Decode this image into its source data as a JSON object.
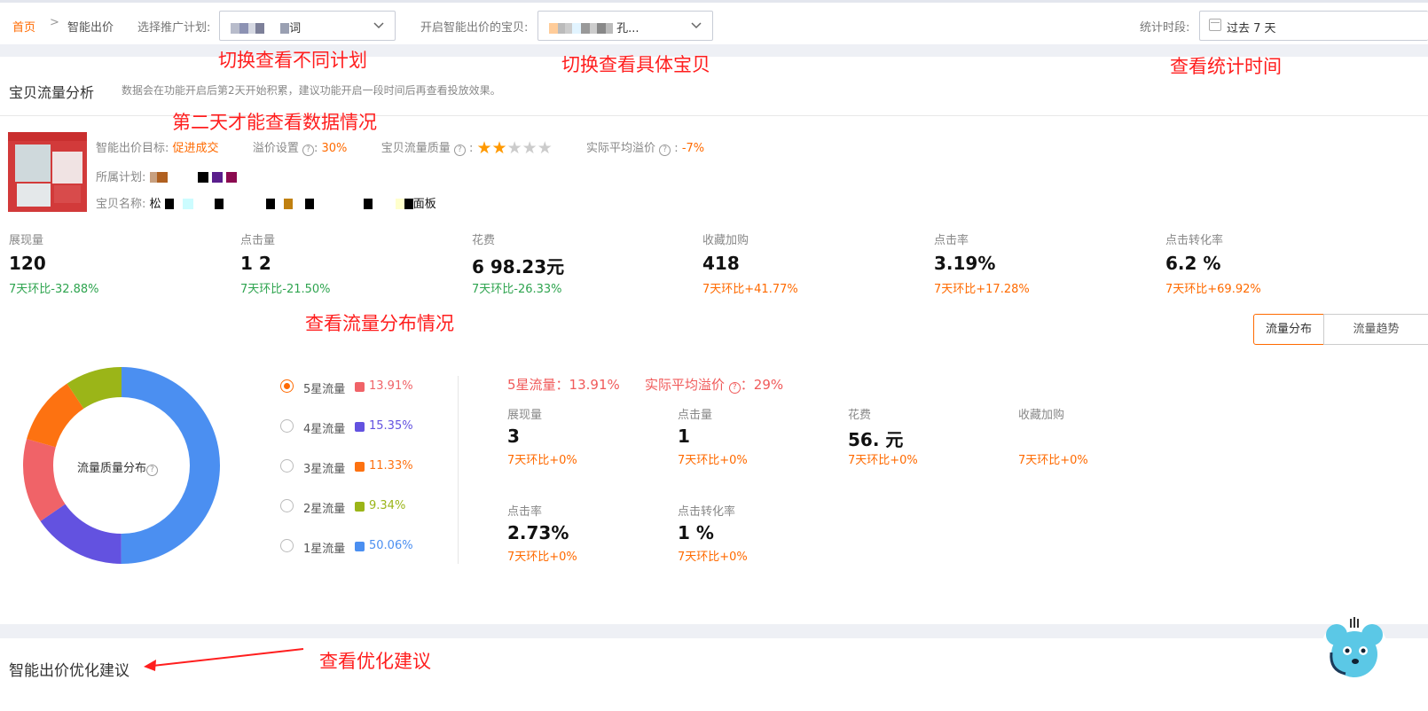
{
  "header": {
    "breadcrumb_home": "首页",
    "breadcrumb_sep": ">",
    "breadcrumb_current": "智能出价",
    "plan_label": "选择推广计划:",
    "plan_value": "词",
    "item_label": "开启智能出价的宝贝:",
    "item_value": "孔...",
    "period_label": "统计时段:",
    "period_value": "过去 7 天"
  },
  "annotations": {
    "switch_plan": "切换查看不同计划",
    "switch_item": "切换查看具体宝贝",
    "view_period": "查看统计时间",
    "day_two": "第二天才能查看数据情况",
    "view_distribution": "查看流量分布情况",
    "view_suggestion": "查看优化建议"
  },
  "analysis": {
    "title": "宝贝流量分析",
    "note": "数据会在功能开启后第2天开始积累，建议功能开启一段时间后再查看投放效果。",
    "goal_label": "智能出价目标:",
    "goal_value": "促进成交",
    "premium_label": "溢价设置",
    "premium_value": "30%",
    "quality_label": "宝贝流量质量",
    "quality_stars": 2,
    "quality_max": 5,
    "avg_premium_label": "实际平均溢价",
    "avg_premium_value": "-7%",
    "plan_label": "所属计划:",
    "name_label": "宝贝名称:",
    "name_start": "松",
    "name_end": "面板"
  },
  "metrics": [
    {
      "label": "展现量",
      "value": "120",
      "change": "7天环比-32.88%",
      "trend": "down"
    },
    {
      "label": "点击量",
      "value": "1 2",
      "change": "7天环比-21.50%",
      "trend": "down"
    },
    {
      "label": "花费",
      "value": "6 98.23元",
      "change": "7天环比-26.33%",
      "trend": "down"
    },
    {
      "label": "收藏加购",
      "value": "418",
      "change": "7天环比+41.77%",
      "trend": "up"
    },
    {
      "label": "点击率",
      "value": "3.19%",
      "change": "7天环比+17.28%",
      "trend": "up"
    },
    {
      "label": "点击转化率",
      "value": "6.2 %",
      "change": "7天环比+69.92%",
      "trend": "up"
    }
  ],
  "tabs": {
    "distribution": "流量分布",
    "trend": "流量趋势"
  },
  "donut": {
    "center_label": "流量质量分布"
  },
  "distribution": [
    {
      "label": "5星流量",
      "pct": "13.91%",
      "value": 13.91,
      "color": "#f06368"
    },
    {
      "label": "4星流量",
      "pct": "15.35%",
      "value": 15.35,
      "color": "#6352e0"
    },
    {
      "label": "3星流量",
      "pct": "11.33%",
      "value": 11.33,
      "color": "#fd7211"
    },
    {
      "label": "2星流量",
      "pct": "9.34%",
      "value": 9.34,
      "color": "#9bb518"
    },
    {
      "label": "1星流量",
      "pct": "50.06%",
      "value": 50.06,
      "color": "#4b8ff1"
    }
  ],
  "detail": {
    "head_flow": "5星流量：13.91%",
    "head_premium_label": "实际平均溢价",
    "head_premium_value": "：29%",
    "metrics": [
      {
        "label": "展现量",
        "value": "3",
        "change": "7天环比+0%"
      },
      {
        "label": "点击量",
        "value": "1",
        "change": "7天环比+0%"
      },
      {
        "label": "花费",
        "value": "56. 元",
        "change": "7天环比+0%"
      },
      {
        "label": "收藏加购",
        "value": "",
        "change": "7天环比+0%"
      },
      {
        "label": "点击率",
        "value": "2.73%",
        "change": "7天环比+0%"
      },
      {
        "label": "点击转化率",
        "value": "1  %",
        "change": "7天环比+0%"
      }
    ]
  },
  "suggestion": {
    "title": "智能出价优化建议"
  },
  "colors": {
    "accent": "#ff6a00",
    "annotation": "#ff1e1e",
    "down": "#2ea44f",
    "up": "#ff6a00"
  }
}
